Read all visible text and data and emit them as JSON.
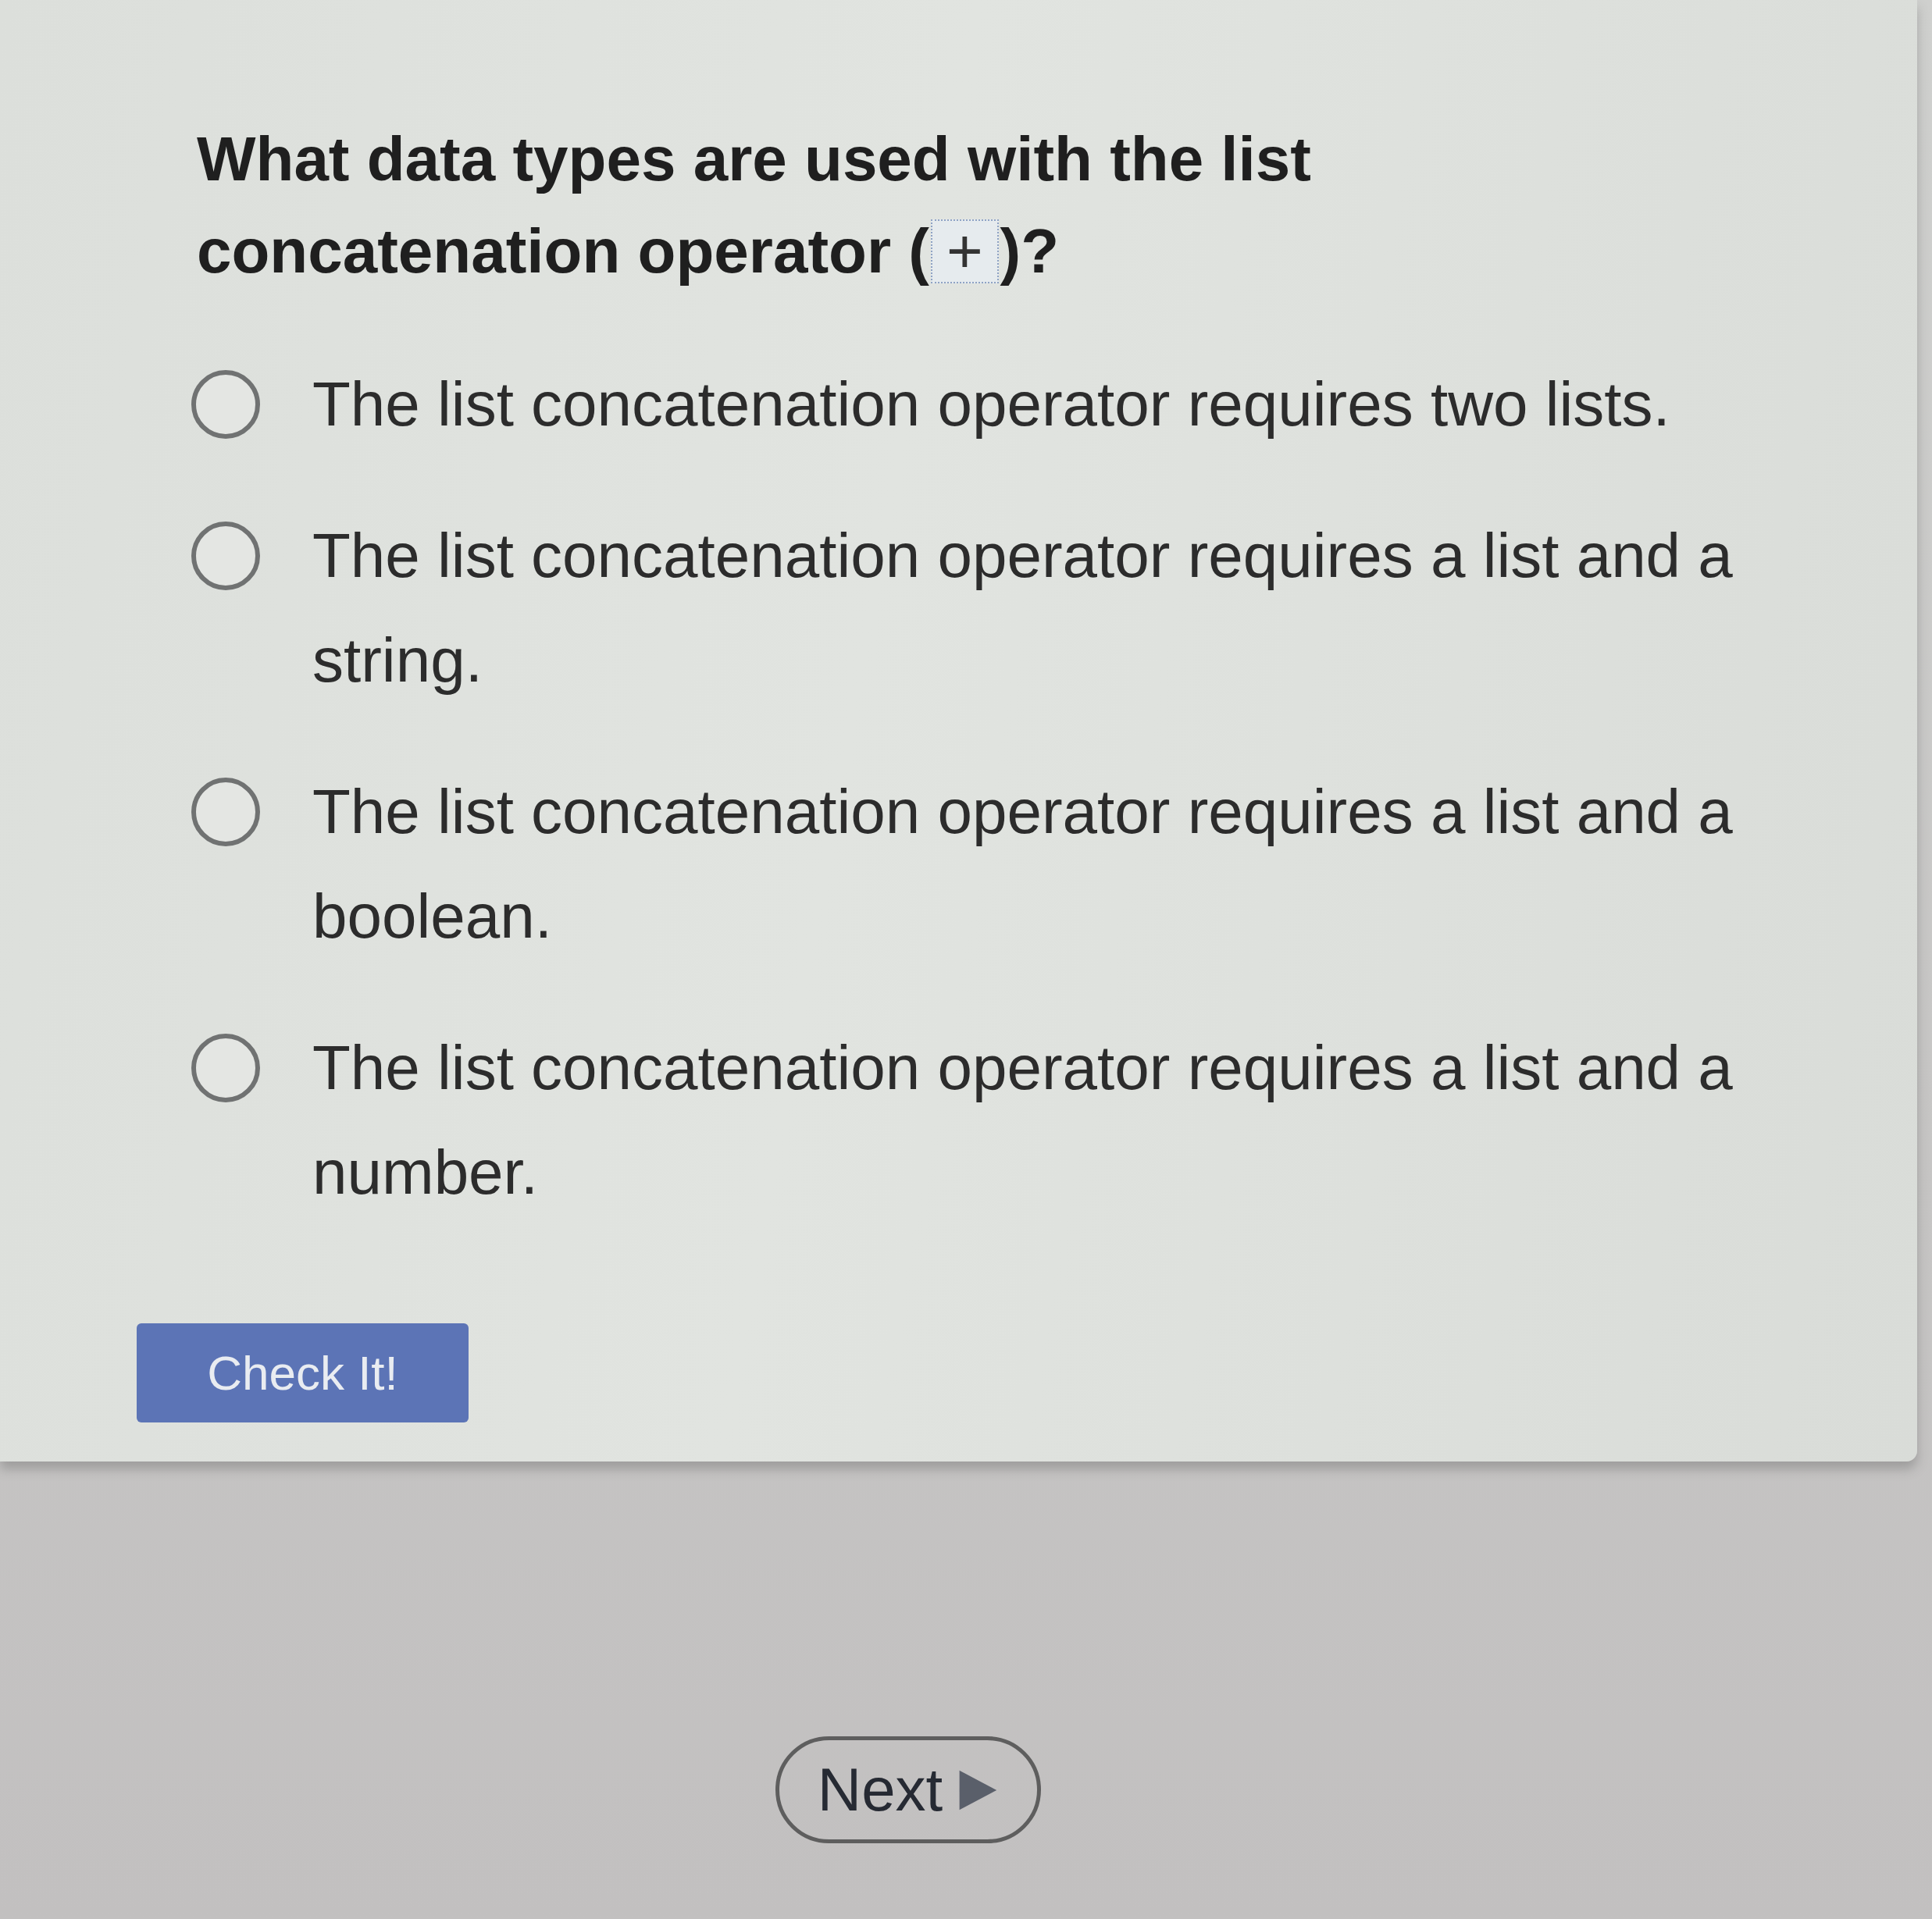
{
  "question": {
    "text": "What data types are used with the list concatenation operator (",
    "operator": "+",
    "closing": ")?"
  },
  "options": [
    {
      "label": "The list concatenation operator requires two lists.",
      "selected": false
    },
    {
      "label": "The list concatenation operator requires a list and a string.",
      "selected": false
    },
    {
      "label": "The list concatenation operator requires a list and a boolean.",
      "selected": false
    },
    {
      "label": "The list concatenation operator requires a list and a number.",
      "selected": false
    }
  ],
  "check_button": {
    "label": "Check It!"
  },
  "next_button": {
    "label": "Next"
  }
}
